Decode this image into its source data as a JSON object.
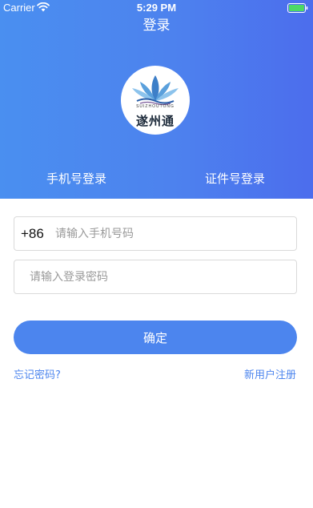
{
  "status_bar": {
    "carrier": "Carrier",
    "time": "5:29 PM",
    "wifi_icon": "wifi-icon",
    "battery_icon": "battery-icon",
    "battery_color": "#4cd964"
  },
  "header": {
    "title": "登录",
    "gradient_start": "#4a8ff0",
    "gradient_end": "#4c6ded"
  },
  "logo": {
    "icon": "lotus-logo-icon",
    "subtitle": "SUIZHOUTONG",
    "name": "遂州通"
  },
  "tabs": [
    {
      "label": "手机号登录",
      "selected": true
    },
    {
      "label": "证件号登录",
      "selected": false
    }
  ],
  "form": {
    "country_code": "+86",
    "phone_placeholder": "请输入手机号码",
    "password_placeholder": "请输入登录密码",
    "confirm_label": "确定",
    "accent_color": "#4c85ee"
  },
  "links": {
    "forgot_password": "忘记密码?",
    "register": "新用户注册"
  }
}
